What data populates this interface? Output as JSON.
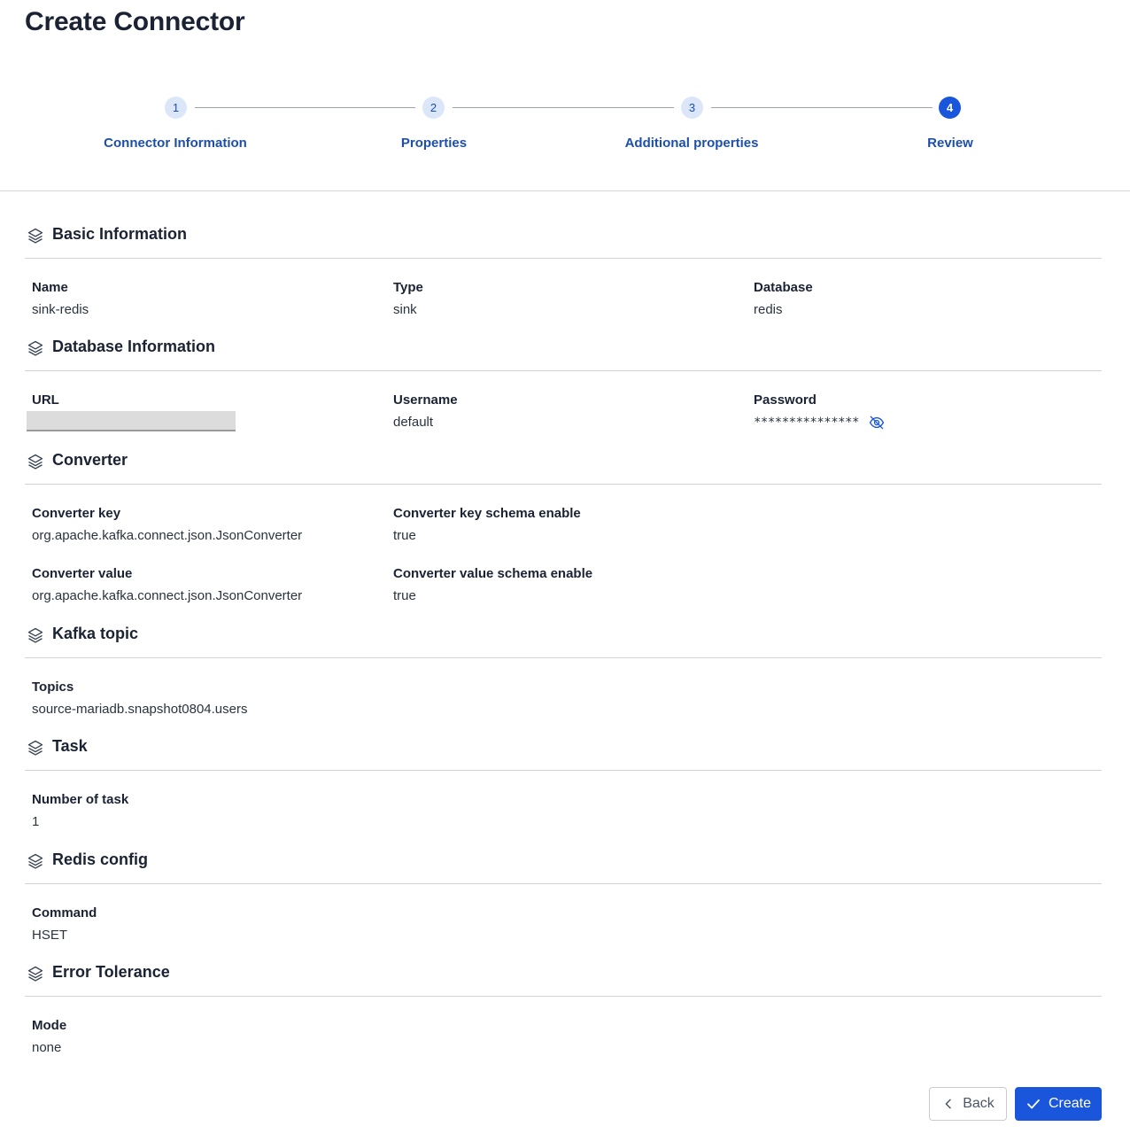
{
  "page": {
    "title": "Create Connector"
  },
  "stepper": {
    "steps": [
      {
        "number": "1",
        "label": "Connector Information"
      },
      {
        "number": "2",
        "label": "Properties"
      },
      {
        "number": "3",
        "label": "Additional properties"
      },
      {
        "number": "4",
        "label": "Review"
      }
    ],
    "active_step": 4
  },
  "sections": {
    "basic": {
      "title": "Basic Information",
      "name_label": "Name",
      "name_value": "sink-redis",
      "type_label": "Type",
      "type_value": "sink",
      "database_label": "Database",
      "database_value": "redis"
    },
    "database": {
      "title": "Database Information",
      "url_label": "URL",
      "username_label": "Username",
      "username_value": "default",
      "password_label": "Password",
      "password_value": "***************"
    },
    "converter": {
      "title": "Converter",
      "key_label": "Converter key",
      "key_value": "org.apache.kafka.connect.json.JsonConverter",
      "key_schema_label": "Converter key schema enable",
      "key_schema_value": "true",
      "value_label": "Converter value",
      "value_value": "org.apache.kafka.connect.json.JsonConverter",
      "value_schema_label": "Converter value schema enable",
      "value_schema_value": "true"
    },
    "kafka": {
      "title": "Kafka topic",
      "topics_label": "Topics",
      "topics_value": "source-mariadb.snapshot0804.users"
    },
    "task": {
      "title": "Task",
      "number_label": "Number of task",
      "number_value": "1"
    },
    "redis": {
      "title": "Redis config",
      "command_label": "Command",
      "command_value": "HSET"
    },
    "error": {
      "title": "Error Tolerance",
      "mode_label": "Mode",
      "mode_value": "none"
    }
  },
  "footer": {
    "back_label": "Back",
    "create_label": "Create"
  },
  "icons": {
    "section": "layers-icon",
    "password_toggle": "eye-off-icon",
    "back": "chevron-left-icon",
    "create": "check-icon"
  },
  "colors": {
    "primary": "#1a56db",
    "step_inactive_bg": "#dbe6f8",
    "step_text": "#1e4fa8",
    "divider": "#d1d5db"
  }
}
